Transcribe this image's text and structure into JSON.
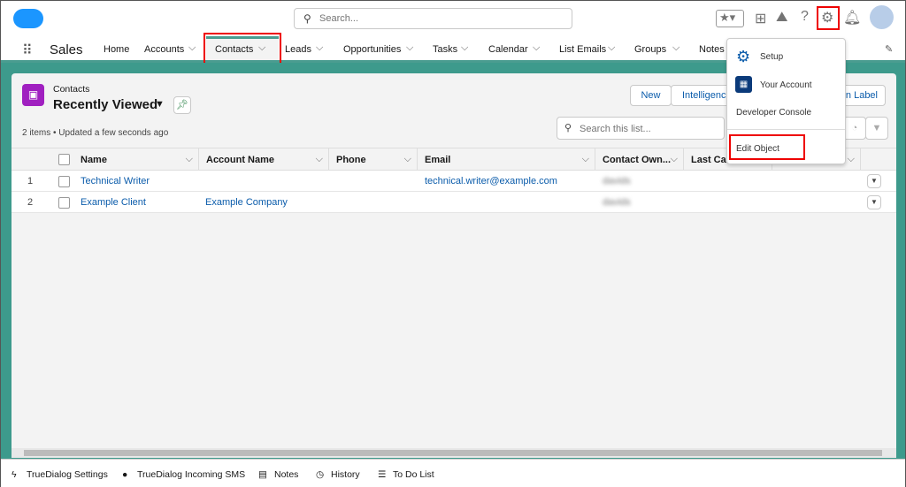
{
  "header": {
    "search_placeholder": "Search..."
  },
  "nav": {
    "app_name": "Sales",
    "items": [
      {
        "label": "Home"
      },
      {
        "label": "Accounts"
      },
      {
        "label": "Contacts",
        "active": true
      },
      {
        "label": "Leads"
      },
      {
        "label": "Opportunities"
      },
      {
        "label": "Tasks"
      },
      {
        "label": "Calendar"
      },
      {
        "label": "List Emails"
      },
      {
        "label": "Groups"
      },
      {
        "label": "Notes"
      }
    ]
  },
  "list": {
    "object": "Contacts",
    "view": "Recently Viewed",
    "status": "2 items • Updated a few seconds ago",
    "search_placeholder": "Search this list...",
    "buttons": {
      "new": "New",
      "intelligence": "Intelligence",
      "label_partial": "n Label"
    }
  },
  "table": {
    "columns": [
      "Name",
      "Account Name",
      "Phone",
      "Email",
      "Contact Own...",
      "Last Can"
    ],
    "rows": [
      {
        "num": "1",
        "name": "Technical Writer",
        "account": "",
        "phone": "",
        "email": "technical.writer@example.com",
        "owner": "davids"
      },
      {
        "num": "2",
        "name": "Example Client",
        "account": "Example Company",
        "phone": "",
        "email": "",
        "owner": "davids"
      }
    ]
  },
  "setup_menu": {
    "items": [
      "Setup",
      "Your Account",
      "Developer Console",
      "Edit Object"
    ]
  },
  "footer": {
    "items": [
      "TrueDialog Settings",
      "TrueDialog Incoming SMS",
      "Notes",
      "History",
      "To Do List"
    ]
  },
  "colors": {
    "brand": "#1b96ff",
    "accent": "#3d9a8c",
    "highlight": "#e00000",
    "contact_icon": "#a020c0"
  }
}
